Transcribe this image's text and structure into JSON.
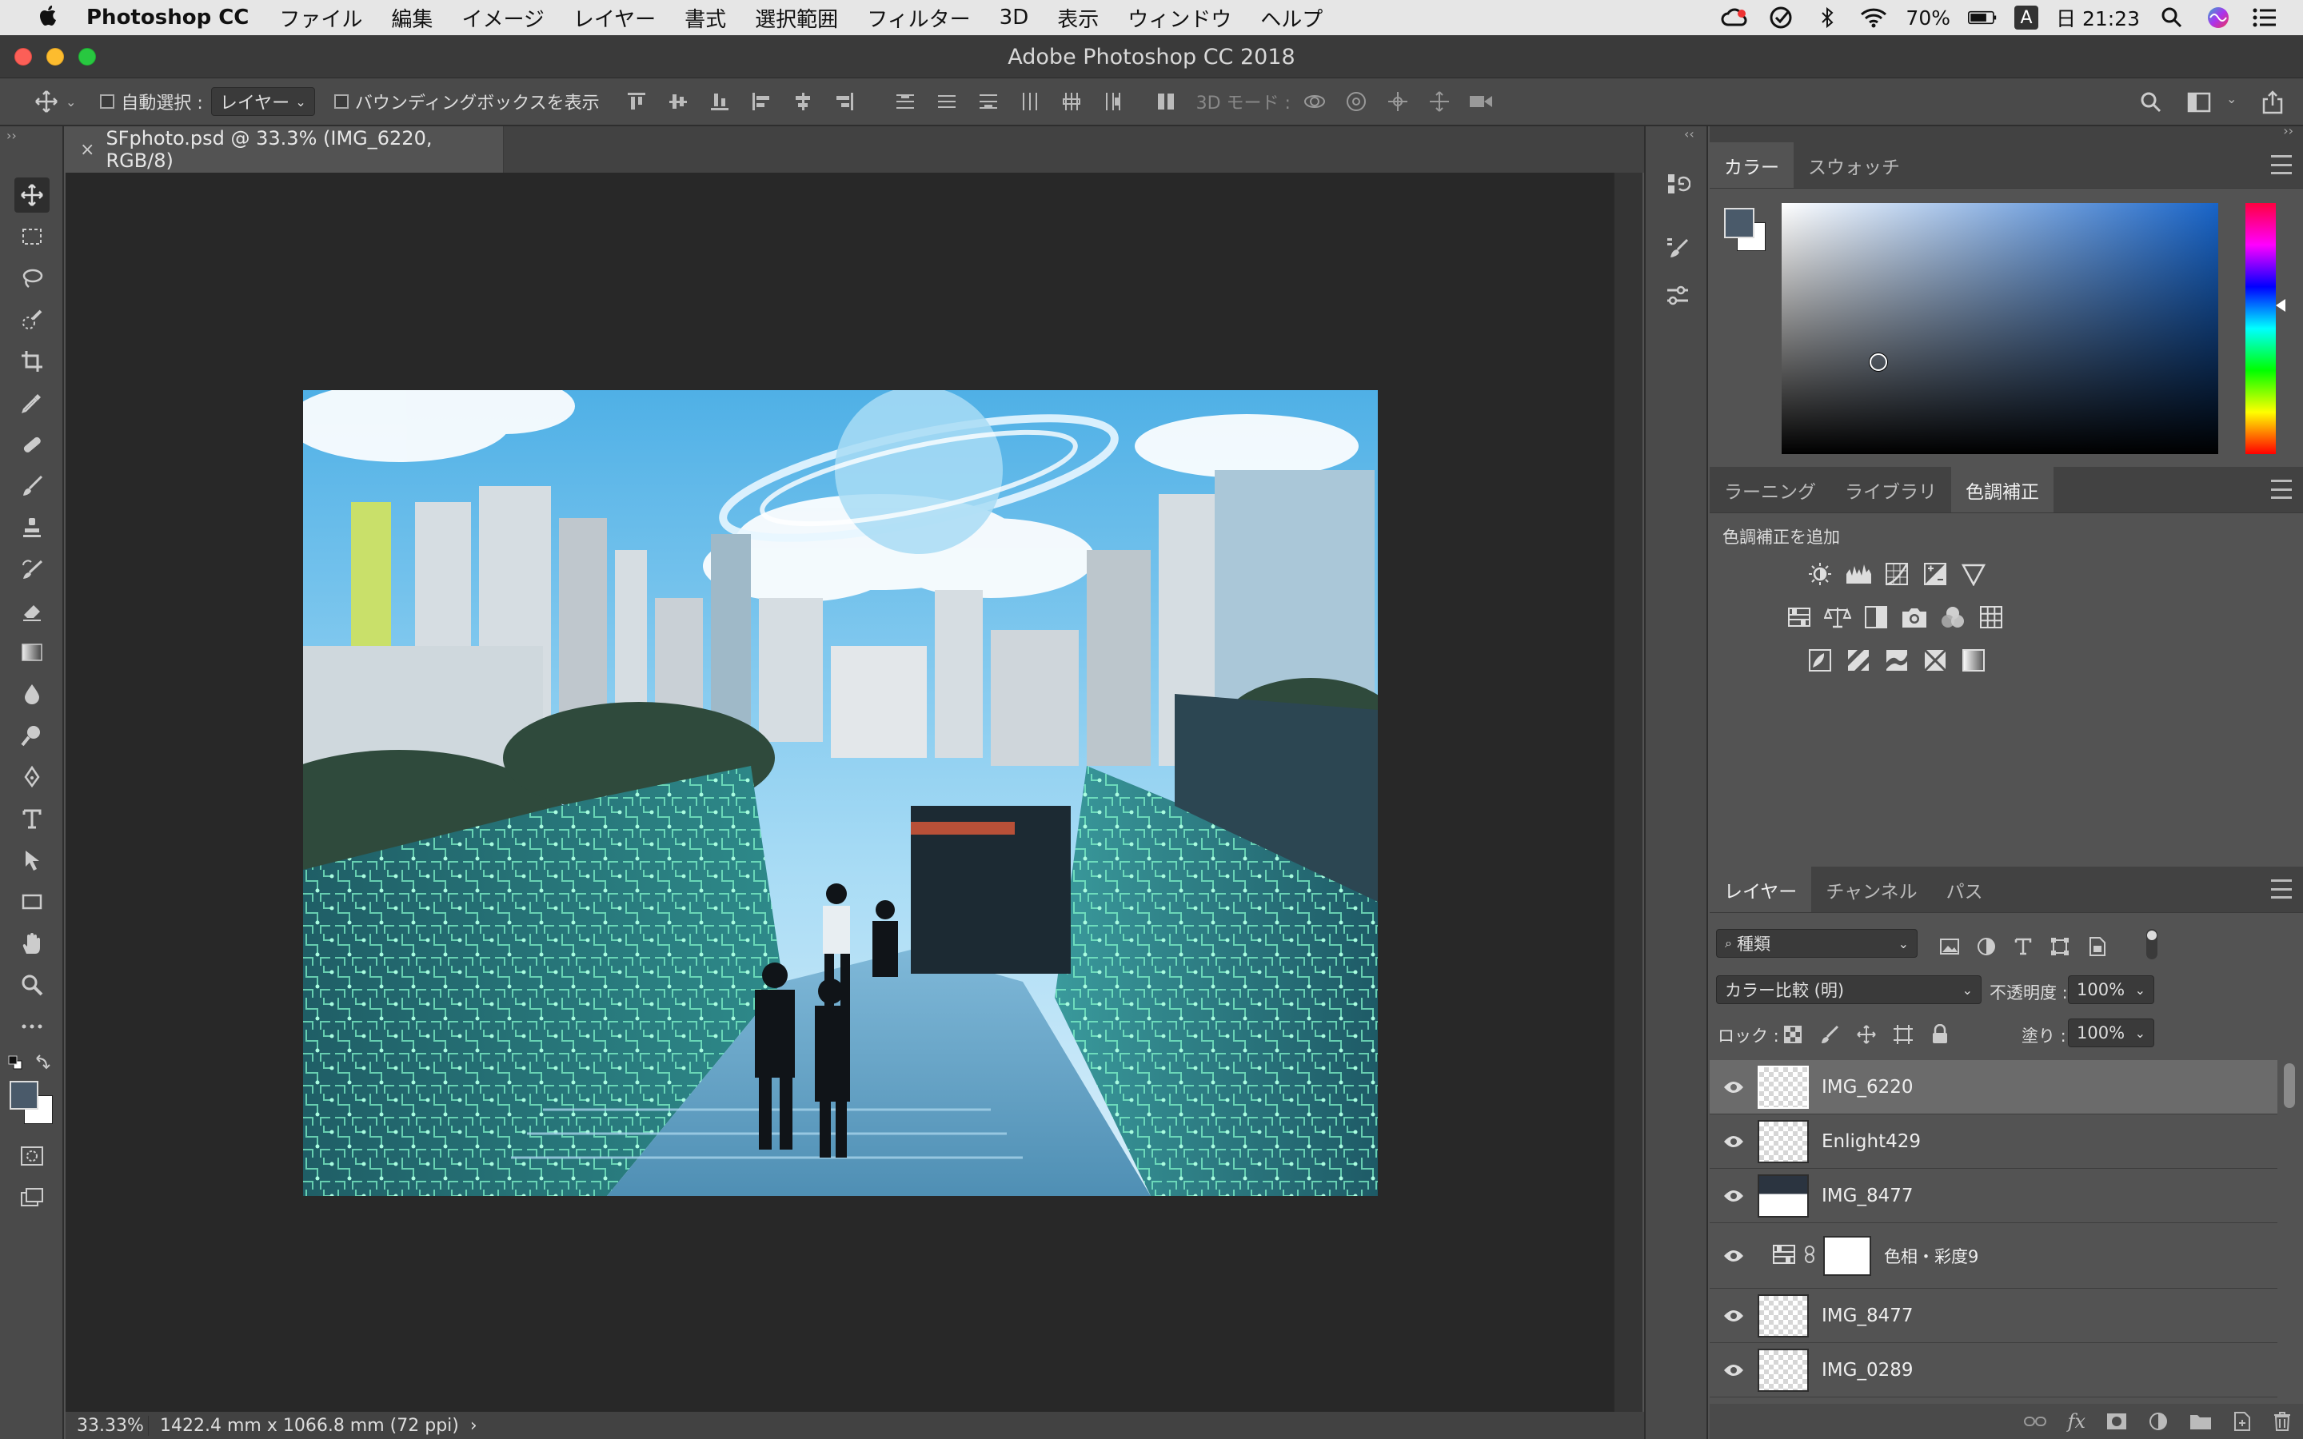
{
  "menubar": {
    "app_name": "Photoshop CC",
    "items": [
      "ファイル",
      "編集",
      "イメージ",
      "レイヤー",
      "書式",
      "選択範囲",
      "フィルター",
      "3D",
      "表示",
      "ウィンドウ",
      "ヘルプ"
    ],
    "battery": "70%",
    "input_mode": "A",
    "clock": "日 21:23"
  },
  "window": {
    "title": "Adobe Photoshop CC 2018"
  },
  "options_bar": {
    "auto_select_label": "自動選択 :",
    "auto_select_value": "レイヤー",
    "bounding_box_label": "バウンディングボックスを表示",
    "mode_3d_label": "3D モード :"
  },
  "document": {
    "tab_title": "SFphoto.psd @ 33.3% (IMG_6220, RGB/8)",
    "zoom": "33.33%",
    "size_info": "1422.4 mm x 1066.8 mm (72 ppi)"
  },
  "color_panel": {
    "tabs": [
      "カラー",
      "スウォッチ"
    ],
    "foreground": "#4a5a6a",
    "background": "#ffffff"
  },
  "adjust_panel": {
    "tabs": [
      "ラーニング",
      "ライブラリ",
      "色調補正"
    ],
    "add_label": "色調補正を追加"
  },
  "layers_panel": {
    "tabs": [
      "レイヤー",
      "チャンネル",
      "パス"
    ],
    "filter_value": "種類",
    "blend_mode": "カラー比較 (明)",
    "opacity_label": "不透明度 :",
    "opacity_value": "100%",
    "lock_label": "ロック :",
    "fill_label": "塗り :",
    "fill_value": "100%",
    "layers": [
      {
        "name": "IMG_6220",
        "selected": true
      },
      {
        "name": "Enlight429",
        "selected": false
      },
      {
        "name": "IMG_8477",
        "selected": false
      },
      {
        "name": "色相・彩度9",
        "selected": false
      },
      {
        "name": "IMG_8477",
        "selected": false
      },
      {
        "name": "IMG_0289",
        "selected": false
      }
    ]
  }
}
